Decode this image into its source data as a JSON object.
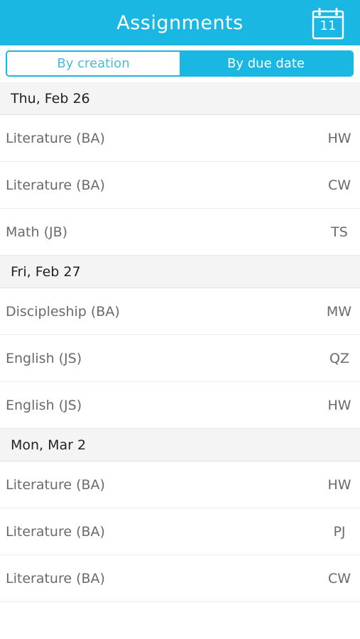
{
  "header": {
    "title": "Assignments",
    "calendar_day": "11"
  },
  "tabs": [
    {
      "label": "By creation",
      "selected": false
    },
    {
      "label": "By due date",
      "selected": true
    }
  ],
  "sections": [
    {
      "date": "Thu, Feb 26",
      "items": [
        {
          "course": "Literature (BA)",
          "type": "HW"
        },
        {
          "course": "Literature (BA)",
          "type": "CW"
        },
        {
          "course": "Math (JB)",
          "type": "TS"
        }
      ]
    },
    {
      "date": "Fri, Feb 27",
      "items": [
        {
          "course": "Discipleship (BA)",
          "type": "MW"
        },
        {
          "course": "English (JS)",
          "type": "QZ"
        },
        {
          "course": "English (JS)",
          "type": "HW"
        }
      ]
    },
    {
      "date": "Mon, Mar 2",
      "items": [
        {
          "course": "Literature (BA)",
          "type": "HW"
        },
        {
          "course": "Literature (BA)",
          "type": "PJ"
        },
        {
          "course": "Literature (BA)",
          "type": "CW"
        }
      ]
    }
  ],
  "colors": {
    "accent": "#1bb7e3",
    "section_bg": "#f4f4f4",
    "text_muted": "#6a6a6a"
  },
  "icons": {
    "calendar": "calendar-icon"
  }
}
